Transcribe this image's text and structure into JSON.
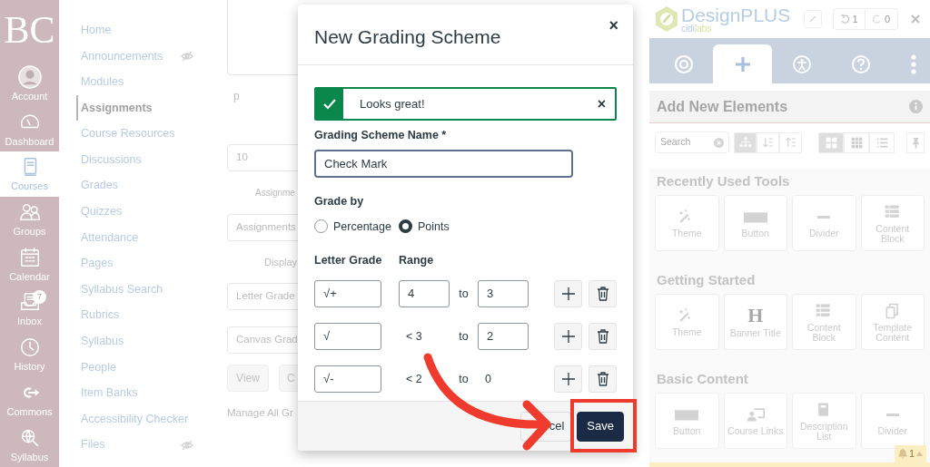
{
  "global_nav": {
    "logo": "BC",
    "items": [
      {
        "label": "Account",
        "selected": false
      },
      {
        "label": "Dashboard",
        "selected": false
      },
      {
        "label": "Courses",
        "selected": true
      },
      {
        "label": "Groups",
        "selected": false
      },
      {
        "label": "Calendar",
        "selected": false
      },
      {
        "label": "Inbox",
        "selected": false,
        "badge": "7"
      },
      {
        "label": "History",
        "selected": false
      },
      {
        "label": "Commons",
        "selected": false
      },
      {
        "label": "Syllabus",
        "selected": false
      }
    ]
  },
  "course_nav": [
    {
      "label": "Home",
      "selected": false,
      "hidden": false
    },
    {
      "label": "Announcements",
      "selected": false,
      "hidden": true
    },
    {
      "label": "Modules",
      "selected": false,
      "hidden": false
    },
    {
      "label": "Assignments",
      "selected": true,
      "hidden": false
    },
    {
      "label": "Course Resources",
      "selected": false,
      "hidden": false
    },
    {
      "label": "Discussions",
      "selected": false,
      "hidden": false
    },
    {
      "label": "Grades",
      "selected": false,
      "hidden": false
    },
    {
      "label": "Quizzes",
      "selected": false,
      "hidden": false
    },
    {
      "label": "Attendance",
      "selected": false,
      "hidden": false
    },
    {
      "label": "Pages",
      "selected": false,
      "hidden": false
    },
    {
      "label": "Syllabus Search",
      "selected": false,
      "hidden": false
    },
    {
      "label": "Rubrics",
      "selected": false,
      "hidden": false
    },
    {
      "label": "Syllabus",
      "selected": false,
      "hidden": false
    },
    {
      "label": "People",
      "selected": false,
      "hidden": false
    },
    {
      "label": "Item Banks",
      "selected": false,
      "hidden": false
    },
    {
      "label": "Accessibility Checker",
      "selected": false,
      "hidden": false
    },
    {
      "label": "Files",
      "selected": false,
      "hidden": true
    }
  ],
  "background_form": {
    "paragraph_label": "p",
    "points_value": "10",
    "group_label": "Assignme",
    "group_value": "Assignments",
    "display_label": "Display",
    "display_value": "Letter Grade",
    "scheme_value": "Canvas Grad",
    "buttons": [
      "View",
      "C"
    ],
    "manage_link": "Manage All Gr"
  },
  "modal": {
    "title": "New Grading Scheme",
    "close": "×",
    "alert": {
      "kind": "success",
      "text": "Looks great!",
      "close": "×"
    },
    "name_label": "Grading Scheme Name *",
    "name_value": "Check Mark",
    "grade_by_label": "Grade by",
    "grade_by_options": [
      {
        "label": "Percentage",
        "selected": false
      },
      {
        "label": "Points",
        "selected": true
      }
    ],
    "columns": [
      "Letter Grade",
      "Range"
    ],
    "rows": [
      {
        "letter": "√+",
        "from": "4",
        "from_editable": true,
        "to_label": "to",
        "to": "3",
        "to_editable": true
      },
      {
        "letter": "√",
        "from": "< 3",
        "from_editable": false,
        "to_label": "to",
        "to": "2",
        "to_editable": true
      },
      {
        "letter": "√-",
        "from": "< 2",
        "from_editable": false,
        "to_label": "to",
        "to": "0",
        "to_editable": false
      }
    ],
    "footer_buttons": [
      {
        "label": "cel",
        "kind": "secondary"
      },
      {
        "label": "Save",
        "kind": "primary"
      }
    ]
  },
  "designplus": {
    "logo": "DesignPLUS",
    "logo_sub": [
      "cidi",
      "labs"
    ],
    "undo_count": "1",
    "redo_count": "0",
    "tabs": [
      {
        "selected": false
      },
      {
        "selected": true
      },
      {
        "selected": false
      },
      {
        "selected": false
      }
    ],
    "section_title": "Add New Elements",
    "search_placeholder": "Search",
    "sort_buttons": [
      {
        "selected": true
      },
      {
        "selected": false
      },
      {
        "selected": false
      }
    ],
    "view_buttons": [
      {
        "selected": true
      },
      {
        "selected": false
      },
      {
        "selected": false
      }
    ],
    "groups": [
      {
        "title": "Recently Used Tools",
        "tools": [
          {
            "label": "Theme"
          },
          {
            "label": "Button"
          },
          {
            "label": "Divider"
          },
          {
            "label": "Content Block"
          }
        ]
      },
      {
        "title": "Getting Started",
        "tools": [
          {
            "label": "Theme"
          },
          {
            "label": "Banner Title",
            "glyph": "H"
          },
          {
            "label": "Content Block"
          },
          {
            "label": "Template Content"
          }
        ]
      },
      {
        "title": "Basic Content",
        "tools": [
          {
            "label": "Button"
          },
          {
            "label": "Course Links"
          },
          {
            "label": "Description List"
          },
          {
            "label": "Divider"
          }
        ]
      }
    ],
    "notification_count": "1"
  }
}
